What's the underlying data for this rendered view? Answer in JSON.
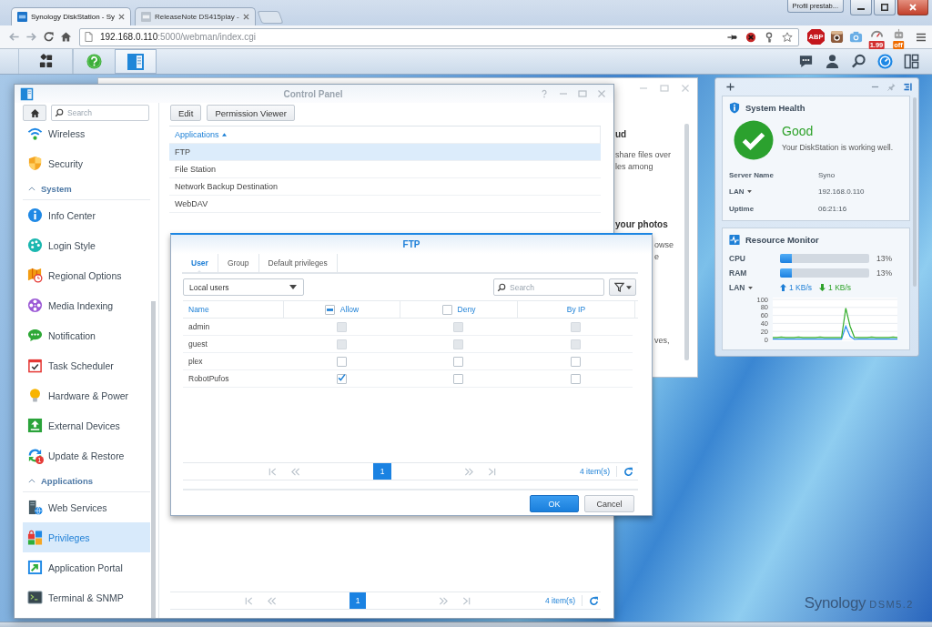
{
  "browser": {
    "tabs": [
      {
        "label": "Synology DiskStation - Sy",
        "selected": true
      },
      {
        "label": "ReleaseNote DS415play -",
        "selected": false
      }
    ],
    "profile_button": "Profil prestab...",
    "address": {
      "host": "192.168.0.110",
      "path": ":5000/webman/index.cgi"
    },
    "adblock_label": "ABP",
    "price_badge": "1.99",
    "robot_badge": "off"
  },
  "dsm_taskbar": {
    "apps": [
      {
        "selected": false
      },
      {
        "selected": true
      }
    ]
  },
  "background_window": {
    "sections": [
      {
        "heading": "ud",
        "lines": [
          "share files over",
          "les among"
        ]
      },
      {
        "heading": "your photos",
        "lines": [
          "owse",
          "e"
        ]
      },
      {
        "lines": [
          "ves,"
        ]
      }
    ]
  },
  "control_panel": {
    "title": "Control Panel",
    "search": {
      "placeholder": "Search"
    },
    "sidebar": [
      {
        "kind": "item",
        "label": "Wireless",
        "selected": false
      },
      {
        "kind": "item",
        "label": "Security",
        "selected": false
      },
      {
        "kind": "header",
        "label": "System",
        "expanded": true
      },
      {
        "kind": "item",
        "label": "Info Center",
        "selected": false
      },
      {
        "kind": "item",
        "label": "Login Style",
        "selected": false
      },
      {
        "kind": "item",
        "label": "Regional Options",
        "selected": false
      },
      {
        "kind": "item",
        "label": "Media Indexing",
        "selected": false
      },
      {
        "kind": "item",
        "label": "Notification",
        "selected": false
      },
      {
        "kind": "item",
        "label": "Task Scheduler",
        "selected": false
      },
      {
        "kind": "item",
        "label": "Hardware & Power",
        "selected": false
      },
      {
        "kind": "item",
        "label": "External Devices",
        "selected": false
      },
      {
        "kind": "item",
        "label": "Update & Restore",
        "selected": false,
        "badge": "1"
      },
      {
        "kind": "header",
        "label": "Applications",
        "expanded": true
      },
      {
        "kind": "item",
        "label": "Web Services",
        "selected": false
      },
      {
        "kind": "item",
        "label": "Privileges",
        "selected": true
      },
      {
        "kind": "item",
        "label": "Application Portal",
        "selected": false
      },
      {
        "kind": "item",
        "label": "Terminal & SNMP",
        "selected": false
      }
    ],
    "toolbar": [
      "Edit",
      "Permission Viewer"
    ],
    "list": {
      "column": "Applications",
      "sort_ascending": true,
      "rows": [
        {
          "label": "FTP",
          "selected": true
        },
        {
          "label": "File Station",
          "selected": false
        },
        {
          "label": "Network Backup Destination",
          "selected": false
        },
        {
          "label": "WebDAV",
          "selected": false
        }
      ]
    },
    "pager": {
      "pages": [
        {
          "label": "1",
          "selected": true
        }
      ],
      "count": "4 item(s)"
    }
  },
  "ftp_dialog": {
    "title": "FTP",
    "tabs": [
      {
        "label": "User",
        "selected": true
      },
      {
        "label": "Group",
        "selected": false
      },
      {
        "label": "Default privileges",
        "selected": false
      }
    ],
    "source": {
      "value": "Local users"
    },
    "search": {
      "placeholder": "Search"
    },
    "columns": [
      {
        "label": "Name"
      },
      {
        "label": "Allow",
        "checkbox": {
          "mixed": true
        }
      },
      {
        "label": "Deny",
        "checkbox": {
          "mixed": false
        }
      },
      {
        "label": "By IP"
      }
    ],
    "rows": [
      {
        "name": "admin",
        "cells": [
          {
            "checked": false,
            "disabled": true
          },
          {
            "checked": false,
            "disabled": true
          },
          {
            "checked": false,
            "disabled": true
          }
        ]
      },
      {
        "name": "guest",
        "cells": [
          {
            "checked": false,
            "disabled": true
          },
          {
            "checked": false,
            "disabled": true
          },
          {
            "checked": false,
            "disabled": true
          }
        ]
      },
      {
        "name": "plex",
        "cells": [
          {
            "checked": false,
            "disabled": false
          },
          {
            "checked": false,
            "disabled": false
          },
          {
            "checked": false,
            "disabled": false
          }
        ]
      },
      {
        "name": "RobotPufos",
        "cells": [
          {
            "checked": true,
            "disabled": false
          },
          {
            "checked": false,
            "disabled": false
          },
          {
            "checked": false,
            "disabled": false
          }
        ]
      }
    ],
    "pager": {
      "pages": [
        {
          "label": "1",
          "selected": true
        }
      ],
      "count": "4 item(s)"
    },
    "buttons": [
      {
        "label": "OK",
        "kind": "primary"
      },
      {
        "label": "Cancel",
        "kind": "secondary"
      }
    ]
  },
  "widgets": {
    "system_health": {
      "title": "System Health",
      "status": "Good",
      "message": "Your DiskStation is working well.",
      "fields": [
        {
          "label": "Server Name",
          "value": "Syno"
        },
        {
          "label": "LAN",
          "value": "192.168.0.110",
          "dropdown": true
        },
        {
          "label": "Uptime",
          "value": "06:21:16"
        }
      ]
    },
    "resource_monitor": {
      "title": "Resource Monitor",
      "meters": [
        {
          "label": "CPU",
          "level": 0.13,
          "reading": "13%"
        },
        {
          "label": "RAM",
          "level": 0.13,
          "reading": "13%"
        }
      ],
      "lan_label": "LAN",
      "upload": "1 KB/s",
      "download": "1 KB/s",
      "chart_data": {
        "type": "line",
        "ylim": [
          0,
          100
        ],
        "yticks": [
          0,
          20,
          40,
          60,
          80,
          100
        ],
        "grid": true,
        "series": [
          {
            "color": "#2a8ff0",
            "values": [
              1,
              1,
              1,
              1,
              1,
              1,
              1,
              1,
              1,
              1,
              1,
              1,
              1,
              1,
              1,
              1,
              1,
              33,
              8,
              0,
              1,
              1,
              1,
              1,
              1,
              1,
              1,
              1,
              1,
              1
            ]
          },
          {
            "color": "#33ad2b",
            "values": [
              5,
              5,
              6,
              5,
              5,
              5,
              6,
              5,
              5,
              5,
              5,
              6,
              5,
              5,
              5,
              5,
              5,
              78,
              33,
              5,
              5,
              5,
              5,
              6,
              5,
              5,
              5,
              5,
              6,
              5
            ]
          }
        ]
      }
    }
  },
  "desktop_logo": {
    "brand": "Synology",
    "version": "DSM5.2"
  }
}
